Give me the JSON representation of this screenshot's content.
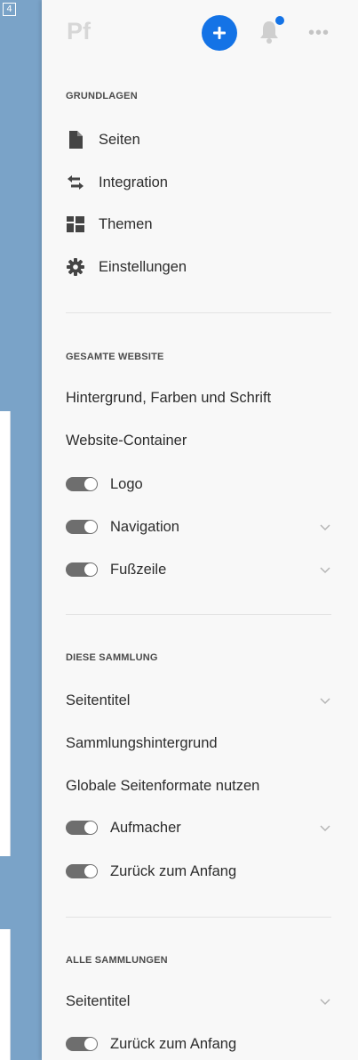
{
  "page_badge": "4",
  "header": {
    "logo_text": "Pf",
    "add_icon": "plus-icon",
    "bell_icon": "bell-icon",
    "more_icon": "more-horizontal-icon",
    "more_text": "•••"
  },
  "colors": {
    "accent": "#1473e6",
    "panel_bg": "#f8f8f8",
    "page_bg": "#7aa3c8",
    "toggle": "#6e6e6e"
  },
  "grundlagen": {
    "title": "GRUNDLAGEN",
    "items": [
      {
        "label": "Seiten",
        "icon": "page-icon"
      },
      {
        "label": "Integration",
        "icon": "swap-arrows-icon"
      },
      {
        "label": "Themen",
        "icon": "layout-grid-icon"
      },
      {
        "label": "Einstellungen",
        "icon": "gear-icon"
      }
    ]
  },
  "gesamte_website": {
    "title": "GESAMTE WEBSITE",
    "items": [
      {
        "label": "Hintergrund, Farben und Schrift"
      },
      {
        "label": "Website-Container"
      },
      {
        "label": "Logo",
        "toggle": true,
        "on": true
      },
      {
        "label": "Navigation",
        "toggle": true,
        "on": true,
        "chevron": true
      },
      {
        "label": "Fußzeile",
        "toggle": true,
        "on": true,
        "chevron": true
      }
    ]
  },
  "diese_sammlung": {
    "title": "DIESE SAMMLUNG",
    "items": [
      {
        "label": "Seitentitel",
        "chevron": true
      },
      {
        "label": "Sammlungshintergrund"
      },
      {
        "label": "Globale Seitenformate nutzen"
      },
      {
        "label": "Aufmacher",
        "toggle": true,
        "on": true,
        "chevron": true
      },
      {
        "label": "Zurück zum Anfang",
        "toggle": true,
        "on": true
      }
    ]
  },
  "alle_sammlungen": {
    "title": "ALLE SAMMLUNGEN",
    "items": [
      {
        "label": "Seitentitel",
        "chevron": true
      },
      {
        "label": "Zurück zum Anfang",
        "toggle": true,
        "on": true
      }
    ]
  }
}
